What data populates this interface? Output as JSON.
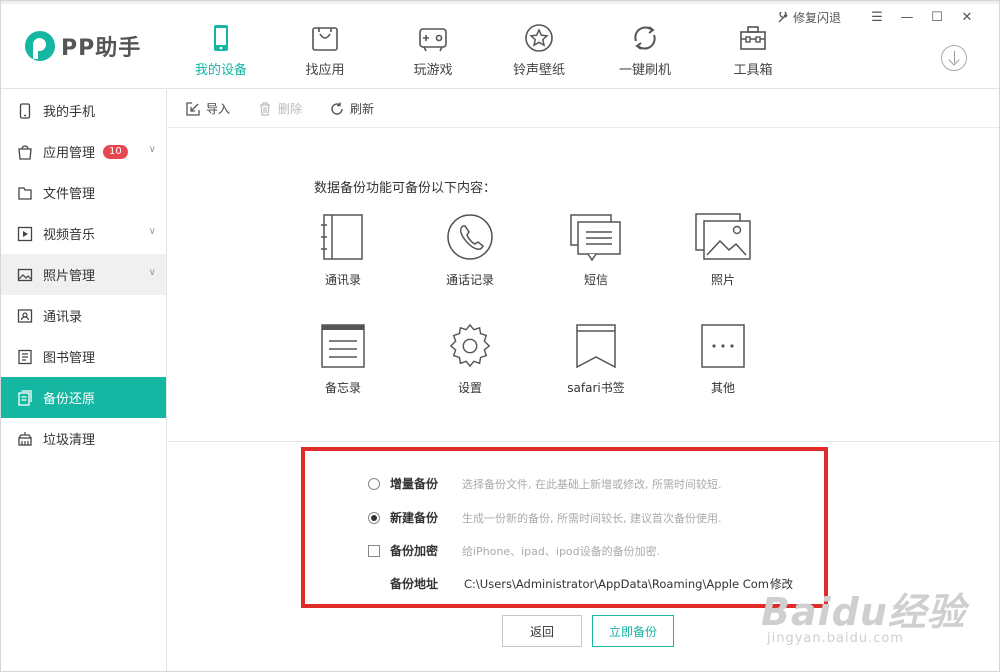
{
  "brand": {
    "name": "PP助手",
    "accent": "#15b6a2"
  },
  "window": {
    "repair_label": "修复闪退"
  },
  "nav": [
    {
      "label": "我的设备",
      "icon": "phone-icon",
      "active": true
    },
    {
      "label": "找应用",
      "icon": "shopping-bag-icon"
    },
    {
      "label": "玩游戏",
      "icon": "gamepad-icon"
    },
    {
      "label": "铃声壁纸",
      "icon": "star-icon"
    },
    {
      "label": "一键刷机",
      "icon": "refresh-icon"
    },
    {
      "label": "工具箱",
      "icon": "toolbox-icon"
    }
  ],
  "sidebar": {
    "items": [
      {
        "label": "我的手机",
        "icon": "phone-icon"
      },
      {
        "label": "应用管理",
        "icon": "apps-icon",
        "badge": "10"
      },
      {
        "label": "文件管理",
        "icon": "folder-icon"
      },
      {
        "label": "视频音乐",
        "icon": "video-icon"
      },
      {
        "label": "照片管理",
        "icon": "image-icon"
      },
      {
        "label": "通讯录",
        "icon": "contact-icon"
      },
      {
        "label": "图书管理",
        "icon": "book-icon"
      },
      {
        "label": "备份还原",
        "icon": "backup-icon",
        "active": true
      },
      {
        "label": "垃圾清理",
        "icon": "broom-icon"
      }
    ]
  },
  "toolbar": {
    "import": "导入",
    "delete": "删除",
    "refresh": "刷新"
  },
  "backup": {
    "intro": "数据备份功能可备份以下内容：",
    "items": [
      {
        "label": "通讯录",
        "icon": "contact-book-icon"
      },
      {
        "label": "通话记录",
        "icon": "call-log-icon"
      },
      {
        "label": "短信",
        "icon": "sms-icon"
      },
      {
        "label": "照片",
        "icon": "photo-icon"
      },
      {
        "label": "备忘录",
        "icon": "memo-icon"
      },
      {
        "label": "设置",
        "icon": "settings-icon"
      },
      {
        "label": "safari书签",
        "icon": "bookmark-icon"
      },
      {
        "label": "其他",
        "icon": "more-icon"
      }
    ],
    "options": {
      "incremental": {
        "label": "增量备份",
        "desc": "选择备份文件, 在此基础上新增或修改, 所需时间较短."
      },
      "new": {
        "label": "新建备份",
        "desc": "生成一份新的备份, 所需时间较长, 建议首次备份使用."
      },
      "encrypt": {
        "label": "备份加密",
        "desc": "给iPhone、ipad、ipod设备的备份加密."
      }
    },
    "path": {
      "label": "备份地址",
      "value": "C:\\Users\\Administrator\\AppData\\Roaming\\Apple Computer",
      "modify": "修改"
    },
    "back_button": "返回",
    "backup_button": "立即备份"
  },
  "watermark": {
    "text": "Baidu经验",
    "url": "jingyan.baidu.com"
  }
}
